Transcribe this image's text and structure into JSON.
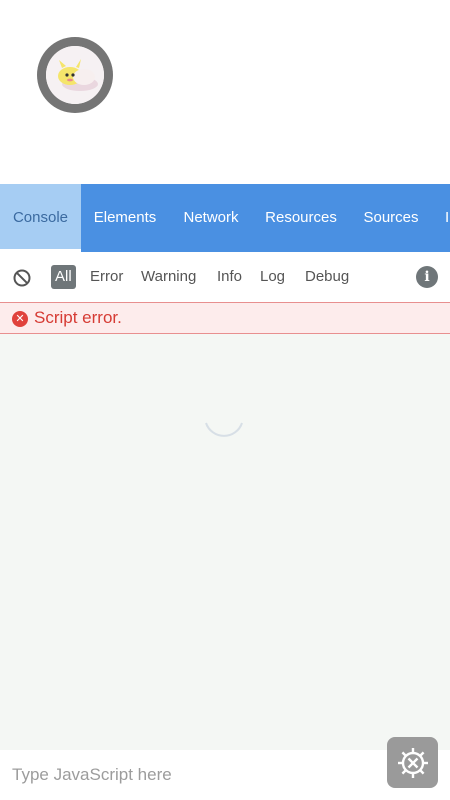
{
  "tabs": [
    {
      "label": "Console",
      "active": true
    },
    {
      "label": "Elements",
      "active": false
    },
    {
      "label": "Network",
      "active": false
    },
    {
      "label": "Resources",
      "active": false
    },
    {
      "label": "Sources",
      "active": false
    },
    {
      "label": "I",
      "active": false
    }
  ],
  "filters": [
    {
      "label": "All",
      "active": true
    },
    {
      "label": "Error",
      "active": false
    },
    {
      "label": "Warning",
      "active": false
    },
    {
      "label": "Info",
      "active": false
    },
    {
      "label": "Log",
      "active": false
    },
    {
      "label": "Debug",
      "active": false
    }
  ],
  "info_icon_glyph": "i",
  "error": {
    "icon_glyph": "✕",
    "message": "Script error."
  },
  "input": {
    "placeholder": "Type JavaScript here"
  },
  "icons": {
    "clear": "clear-console-icon",
    "info": "info-icon",
    "error": "error-icon",
    "spinner": "loading-spinner-icon",
    "settings": "settings-gear-icon",
    "avatar": "avatar-image"
  },
  "colors": {
    "tab_bar": "#4a90e2",
    "tab_active": "#a6cdf3",
    "error_text": "#d63b34",
    "error_bg": "#fdecec",
    "log_bg": "#f4f7f4"
  }
}
